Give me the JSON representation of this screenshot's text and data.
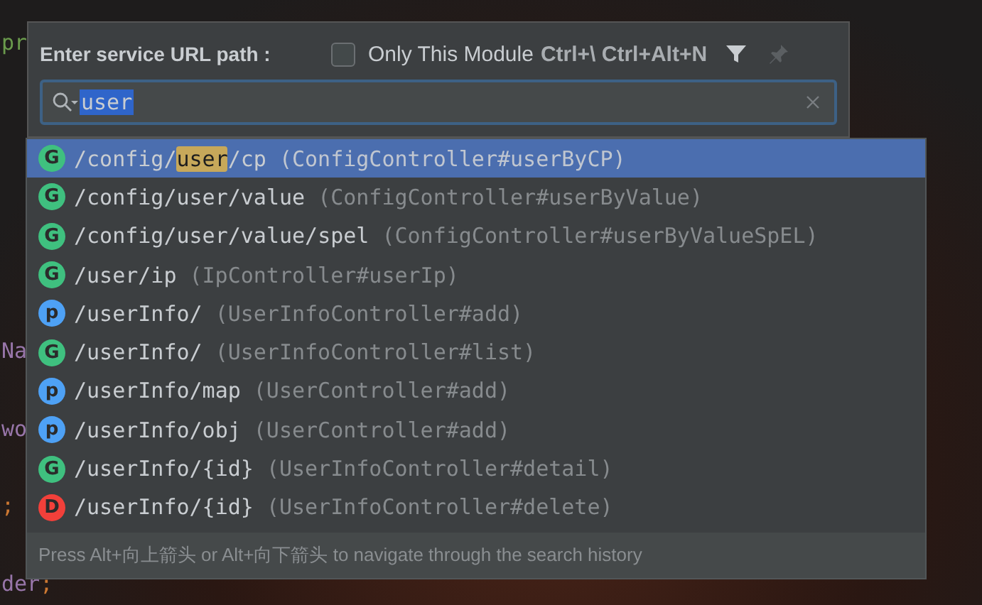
{
  "editor": {
    "fragments": [
      {
        "text": "pr",
        "kind": "string"
      },
      {
        "text": "Na",
        "kind": "field"
      },
      {
        "text": "wo",
        "kind": "field"
      },
      {
        "text": ";",
        "kind": "punct"
      },
      {
        "text": "der",
        "kind": "field"
      },
      {
        "text": ";",
        "kind": "punct"
      }
    ]
  },
  "popup": {
    "title": "Enter service URL path :",
    "module_filter": {
      "checked": false,
      "label": "Only This Module",
      "shortcut": "Ctrl+\\ Ctrl+Alt+N"
    },
    "search": {
      "value": "user"
    },
    "results": [
      {
        "method": "G",
        "color": "#3fc07f",
        "path": [
          {
            "text": "/config/",
            "match": false
          },
          {
            "text": "user",
            "match": true
          },
          {
            "text": "/cp",
            "match": false
          }
        ],
        "handler": "(ConfigController#userByCP)",
        "selected": true
      },
      {
        "method": "G",
        "color": "#3fc07f",
        "path": "/config/user/value",
        "handler": "(ConfigController#userByValue)",
        "selected": false
      },
      {
        "method": "G",
        "color": "#3fc07f",
        "path": "/config/user/value/spel",
        "handler": "(ConfigController#userByValueSpEL)",
        "selected": false
      },
      {
        "method": "G",
        "color": "#3fc07f",
        "path": "/user/ip",
        "handler": "(IpController#userIp)",
        "selected": false
      },
      {
        "method": "p",
        "color": "#4ea1f5",
        "path": "/userInfo/",
        "handler": "(UserInfoController#add)",
        "selected": false
      },
      {
        "method": "G",
        "color": "#3fc07f",
        "path": "/userInfo/",
        "handler": "(UserInfoController#list)",
        "selected": false
      },
      {
        "method": "p",
        "color": "#4ea1f5",
        "path": "/userInfo/map",
        "handler": "(UserController#add)",
        "selected": false
      },
      {
        "method": "p",
        "color": "#4ea1f5",
        "path": "/userInfo/obj",
        "handler": "(UserController#add)",
        "selected": false
      },
      {
        "method": "G",
        "color": "#3fc07f",
        "path": "/userInfo/{id}",
        "handler": "(UserInfoController#detail)",
        "selected": false
      },
      {
        "method": "D",
        "color": "#f2403a",
        "path": "/userInfo/{id}",
        "handler": "(UserInfoController#delete)",
        "selected": false
      }
    ],
    "hint": "Press Alt+向上箭头 or Alt+向下箭头 to navigate through the search history"
  }
}
